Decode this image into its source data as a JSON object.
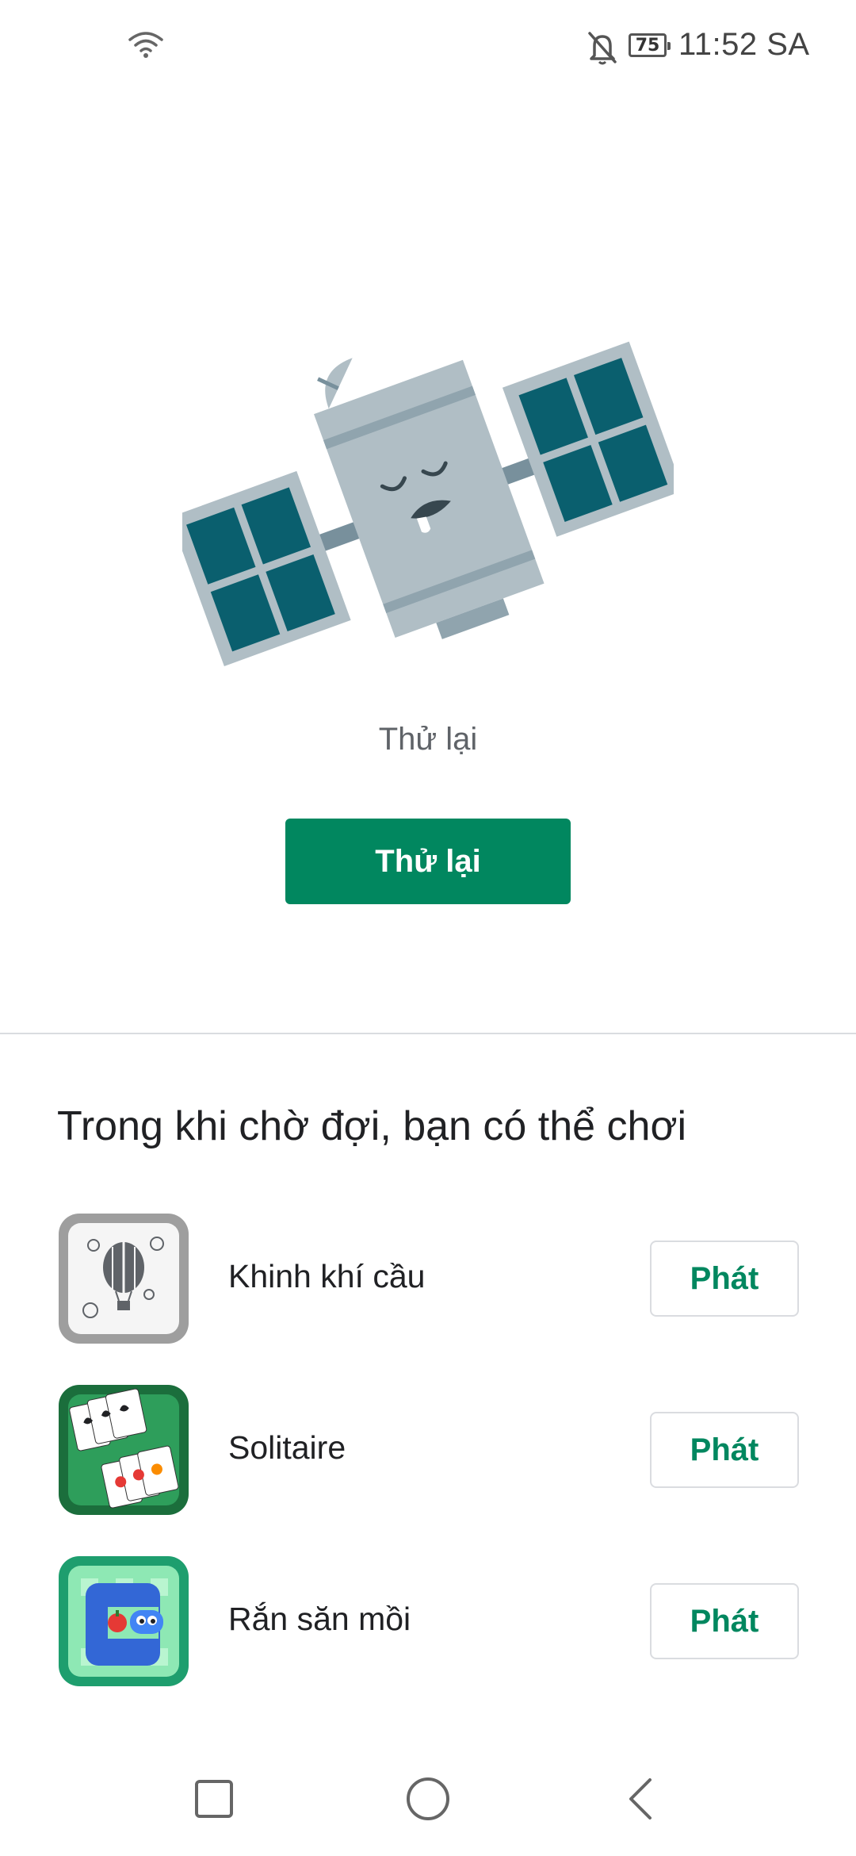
{
  "status_bar": {
    "time": "11:52 SA",
    "battery_level": "75",
    "icons": [
      "wifi-icon",
      "bell-off-icon",
      "battery-icon"
    ]
  },
  "illustration": {
    "icon": "sleeping-satellite-illustration"
  },
  "error": {
    "message": "Thử lại",
    "retry_label": "Thử lại"
  },
  "games_section": {
    "title": "Trong khi chờ đợi, bạn có thể chơi",
    "games": [
      {
        "name": "Khinh khí cầu",
        "icon": "balloon-game-icon",
        "play_label": "Phát"
      },
      {
        "name": "Solitaire",
        "icon": "solitaire-game-icon",
        "play_label": "Phát"
      },
      {
        "name": "Rắn săn mồi",
        "icon": "snake-game-icon",
        "play_label": "Phát"
      }
    ]
  },
  "nav_bar": {
    "icons": [
      "recents-square-icon",
      "home-circle-icon",
      "back-chevron-icon"
    ]
  },
  "colors": {
    "accent": "#01875f",
    "satellite_body": "#b0bec5",
    "solar_panel": "#0a5f6e"
  }
}
